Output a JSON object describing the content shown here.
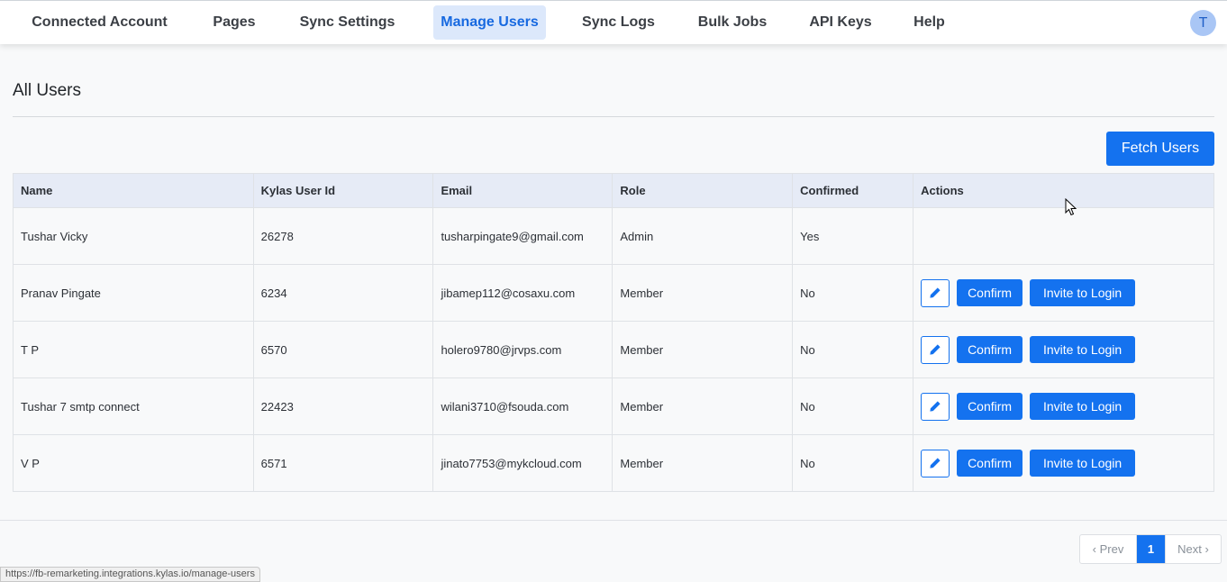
{
  "nav": {
    "items": [
      {
        "label": "Connected Account",
        "active": false
      },
      {
        "label": "Pages",
        "active": false
      },
      {
        "label": "Sync Settings",
        "active": false
      },
      {
        "label": "Manage Users",
        "active": true
      },
      {
        "label": "Sync Logs",
        "active": false
      },
      {
        "label": "Bulk Jobs",
        "active": false
      },
      {
        "label": "API Keys",
        "active": false
      },
      {
        "label": "Help",
        "active": false
      }
    ],
    "avatar_initial": "T"
  },
  "page": {
    "title": "All Users",
    "fetch_button": "Fetch Users"
  },
  "table": {
    "columns": [
      "Name",
      "Kylas User Id",
      "Email",
      "Role",
      "Confirmed",
      "Actions"
    ],
    "rows": [
      {
        "name": "Tushar Vicky",
        "user_id": "26278",
        "email": "tusharpingate9@gmail.com",
        "role": "Admin",
        "confirmed": "Yes",
        "show_actions": false
      },
      {
        "name": "Pranav Pingate",
        "user_id": "6234",
        "email": "jibamep112@cosaxu.com",
        "role": "Member",
        "confirmed": "No",
        "show_actions": true
      },
      {
        "name": "T P",
        "user_id": "6570",
        "email": "holero9780@jrvps.com",
        "role": "Member",
        "confirmed": "No",
        "show_actions": true
      },
      {
        "name": "Tushar 7 smtp connect",
        "user_id": "22423",
        "email": "wilani3710@fsouda.com",
        "role": "Member",
        "confirmed": "No",
        "show_actions": true
      },
      {
        "name": "V P",
        "user_id": "6571",
        "email": "jinato7753@mykcloud.com",
        "role": "Member",
        "confirmed": "No",
        "show_actions": true
      }
    ],
    "actions": {
      "edit_icon": "pencil-icon",
      "confirm_label": "Confirm",
      "invite_label": "Invite to Login"
    }
  },
  "pagination": {
    "prev_label": "‹ Prev",
    "current_page": "1",
    "next_label": "Next ›"
  },
  "status_bar": {
    "url": "https://fb-remarketing.integrations.kylas.io/manage-users"
  },
  "colors": {
    "primary": "#1472ef",
    "active_tab_bg": "#dce8fb",
    "header_row_bg": "#e6ebf6"
  }
}
